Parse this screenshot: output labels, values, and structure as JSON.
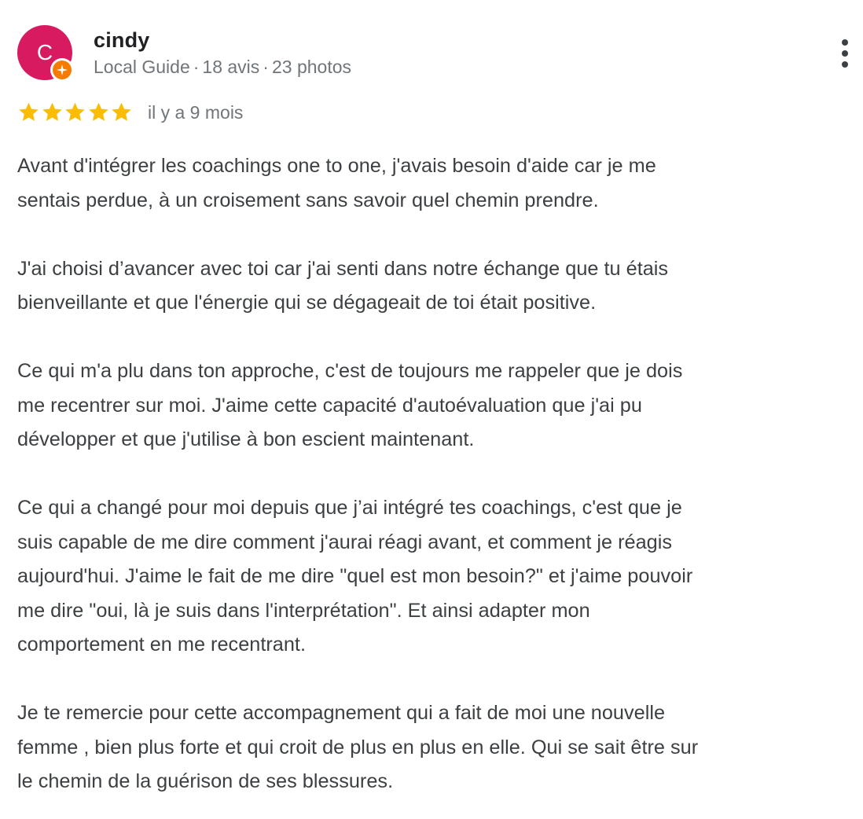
{
  "reviewer": {
    "avatar_initial": "C",
    "avatar_color": "#d81b60",
    "name": "cindy",
    "badge": "Local Guide",
    "reviews": "18 avis",
    "photos": "23 photos",
    "separator": "·"
  },
  "rating": {
    "stars": 5,
    "max_stars": 5,
    "star_color": "#fbbc04",
    "age": "il y a 9 mois"
  },
  "review_body": {
    "paragraphs": [
      [
        "Avant d'intégrer les coachings one to one, j'avais besoin d'aide car je me",
        "sentais perdue, à un croisement sans savoir quel chemin prendre."
      ],
      [
        "J'ai choisi d’avancer avec toi car j'ai senti dans notre échange que tu étais",
        "bienveillante et que l'énergie qui se dégageait de toi était positive."
      ],
      [
        "Ce qui m'a plu dans ton approche, c'est de toujours me rappeler que je dois",
        "me recentrer sur moi. J'aime cette capacité d'autoévaluation que j'ai pu",
        "développer et que j'utilise à bon escient maintenant."
      ],
      [
        "Ce qui a changé pour moi depuis que j’ai intégré tes coachings, c'est que je",
        "suis capable de me dire comment j'aurai réagi avant, et comment je réagis",
        "aujourd'hui. J'aime le fait de me dire \"quel est mon besoin?\" et j'aime pouvoir",
        "me dire \"oui, là je suis dans l'interprétation\". Et ainsi adapter mon",
        "comportement en me recentrant."
      ],
      [
        "Je te remercie pour cette accompagnement qui a fait de moi une nouvelle",
        "femme , bien plus forte et qui croit de plus en plus en elle. Qui se sait être sur",
        "le chemin de la guérison de ses blessures."
      ]
    ]
  },
  "icons": {
    "more": "more-vertical-icon",
    "star": "star-icon",
    "local_guide": "local-guide-badge-icon"
  }
}
